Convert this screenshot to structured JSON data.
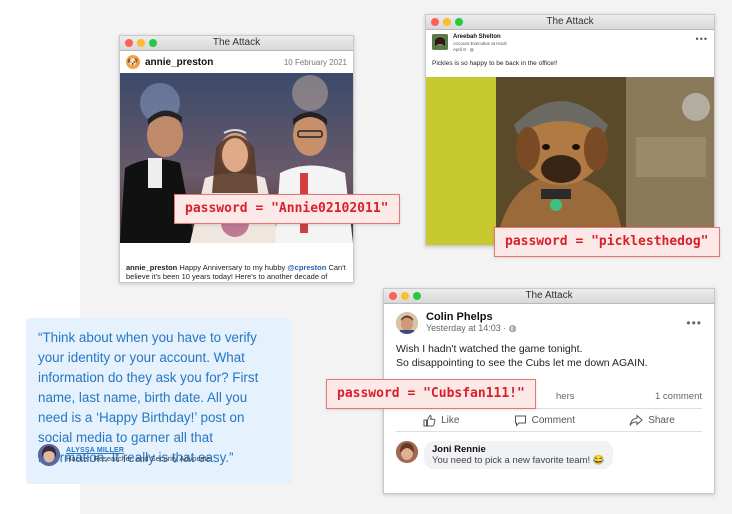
{
  "windows": {
    "instagram": {
      "title": "The Attack",
      "username": "annie_preston",
      "date": "10 February 2021",
      "caption_user": "annie_preston",
      "caption_text": "Happy Anniversary to my hubby",
      "mention": "@cpreston",
      "caption_rest": "Can't believe it's been 10 years today! Here's to another decade of laughs. I love you!",
      "password": "password = \"Annie02102011\""
    },
    "linkedin": {
      "title": "The Attack",
      "name": "Areebah Shelton",
      "role": "Account Executive at Hooli",
      "date": "April 8 · ◍",
      "post": "Pickles is so happy to be back in the office!!",
      "more": "•••",
      "password": "password = \"picklesthedog\""
    },
    "facebook": {
      "title": "The Attack",
      "name": "Colin Phelps",
      "time": "Yesterday at 14:03 · ◍",
      "more": "•••",
      "line1": "Wish I hadn't watched the game tonight.",
      "line2": "So disappointing to see the Cubs let me down AGAIN.",
      "others": "hers",
      "comments": "1 comment",
      "like": "Like",
      "comment": "Comment",
      "share": "Share",
      "commenter": "Joni Rennie",
      "comment_text": "You need to pick a new favorite team! 😂",
      "password": "password = \"Cubsfan111!\""
    }
  },
  "quote": {
    "text": "“Think about when you have to verify your identity or your account. What information do they ask you for? First name, last name, birth date. All you need is a ‘Happy Birthday!’ post on social media to garner all that information. It really is that easy.”",
    "author": "ALYSSA MILLER",
    "role": "Hacker, Researcher, and Security Advocate"
  },
  "colors": {
    "accent": "#2677c4",
    "password_text": "#d8202a",
    "password_bg": "#fde8e8"
  }
}
